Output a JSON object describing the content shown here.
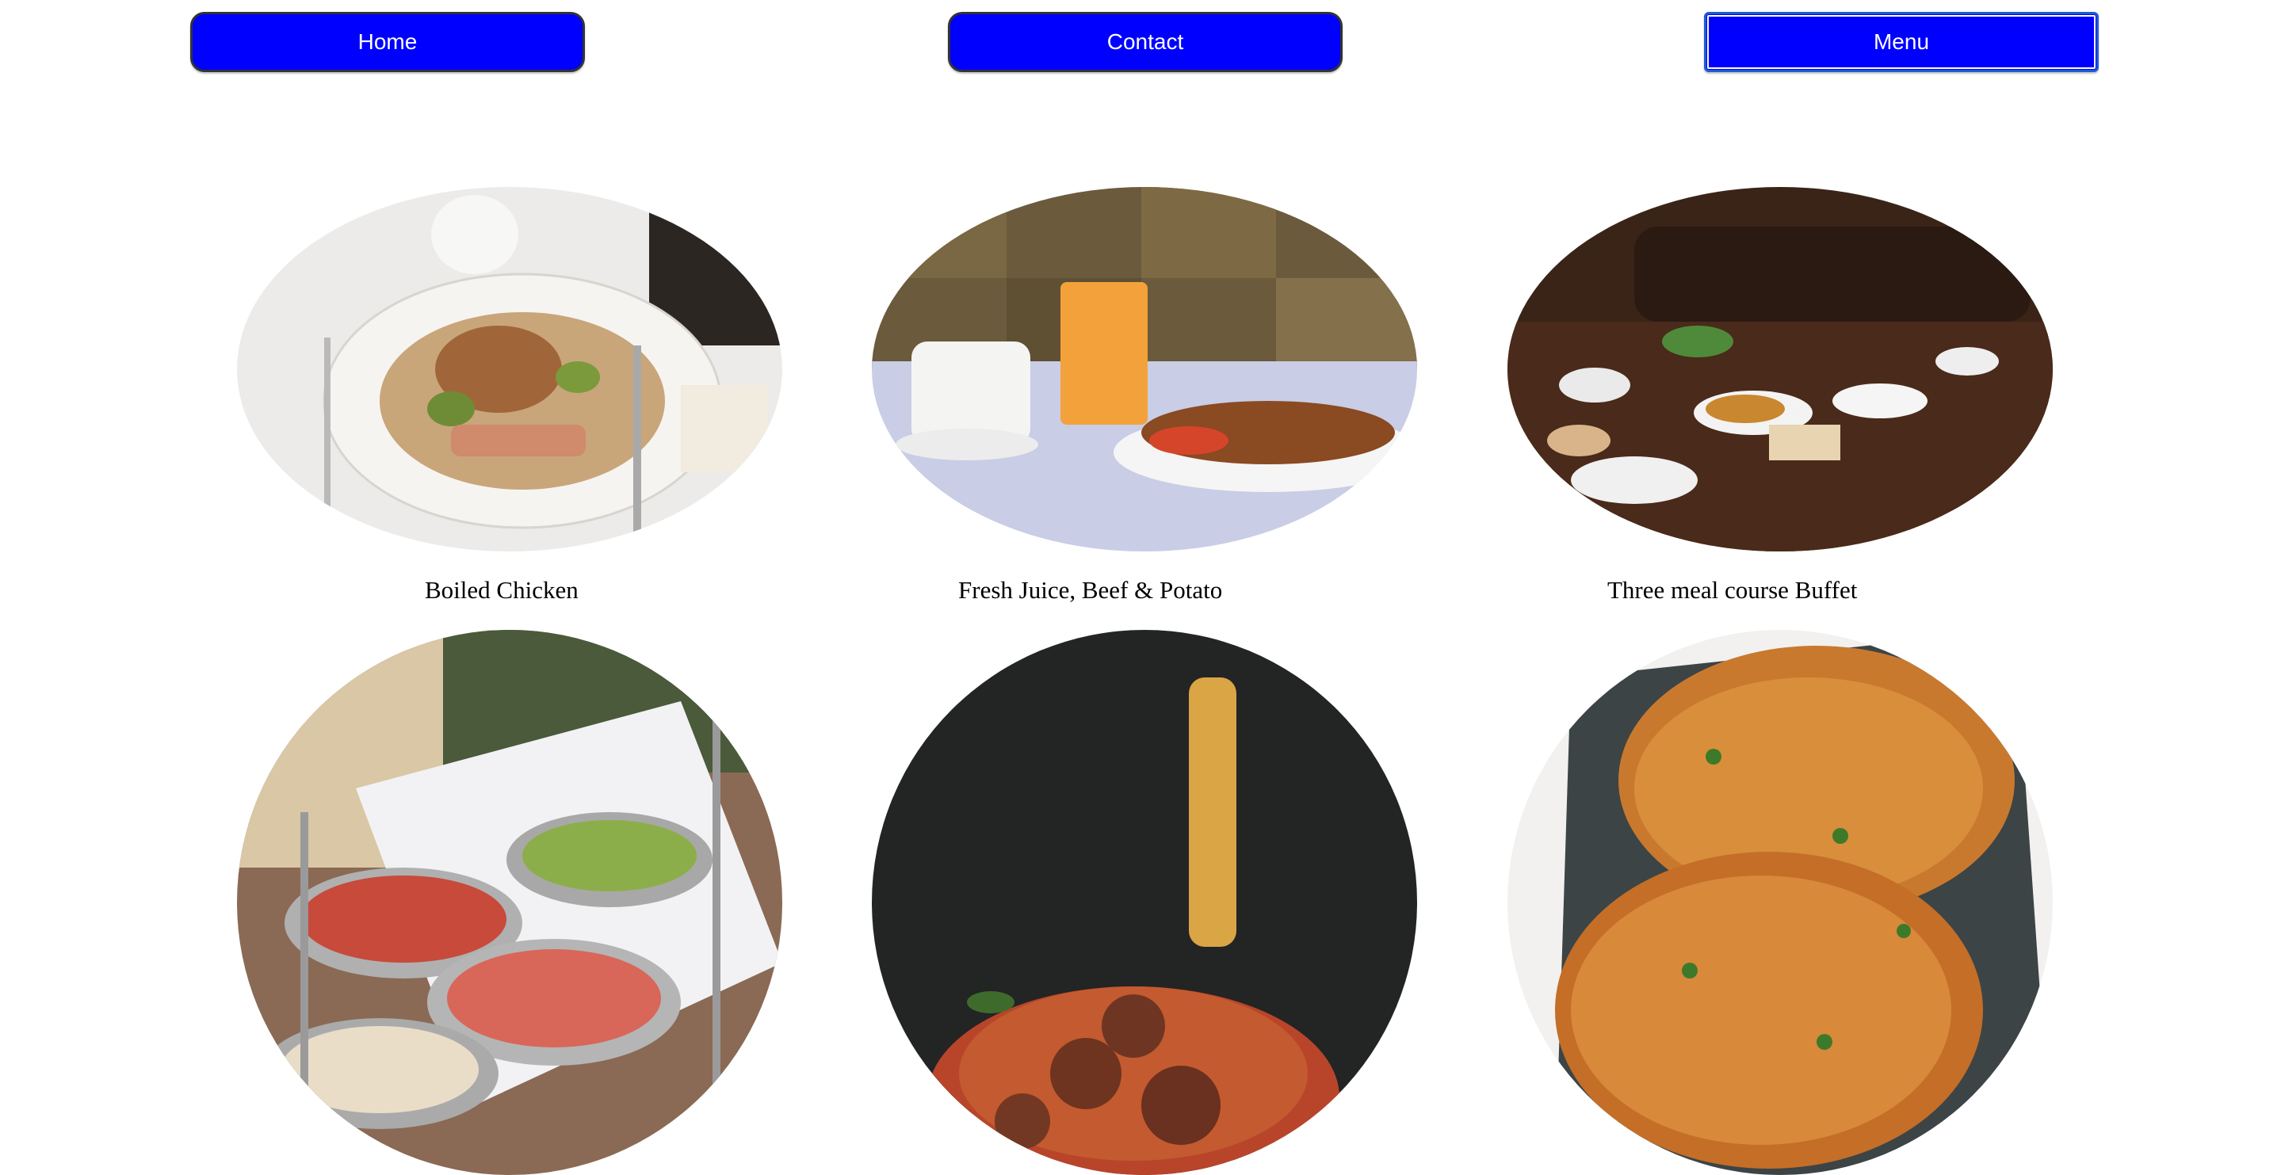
{
  "nav": {
    "buttons": [
      {
        "label": "Home"
      },
      {
        "label": "Contact"
      },
      {
        "label": "Menu",
        "state": "focused"
      }
    ],
    "button_color": "#0000ff"
  },
  "menu_items": [
    {
      "caption": "Boiled Chicken",
      "image": "plated-roast-duck-with-brussels-sprouts"
    },
    {
      "caption": "Fresh Juice, Beef & Potato",
      "image": "orange-juice-coffee-cup-and-beef-potato-plate"
    },
    {
      "caption": "Three meal course Buffet",
      "image": "restaurant-table-set-with-many-dishes"
    },
    {
      "caption": "",
      "image": "tiered-charcuterie-platters"
    },
    {
      "caption": "",
      "image": "spaghetti-and-meatballs-on-fork"
    },
    {
      "caption": "",
      "image": "breaded-fried-chicken-cutlets"
    }
  ]
}
